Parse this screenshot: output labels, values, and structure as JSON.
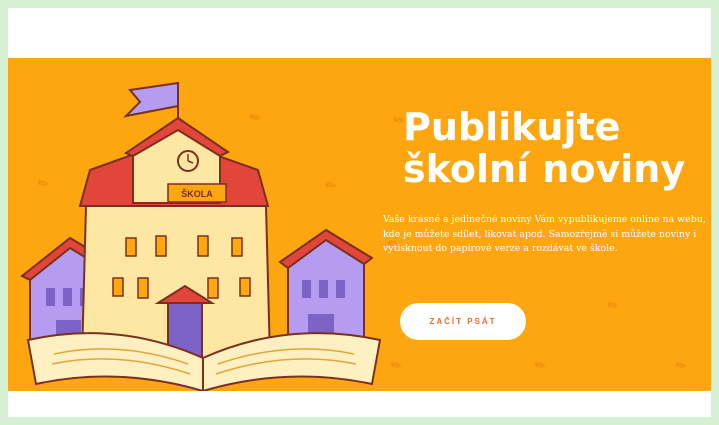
{
  "hero": {
    "title_line1": "Publikujte",
    "title_line2": "školní noviny",
    "description": "Vaše krásné a jedinečné noviny Vám vypublikujeme online na webu, kde je můžete sdílet, likovat apod. Samozřejmě si můžete noviny i vytisknout do papírové verze a rozdávat ve škole.",
    "cta_label": "ZAČÍT PSÁT",
    "illustration_sign": "ŠKOLA"
  },
  "colors": {
    "page_border": "#d6f0d3",
    "hero_background": "#fda60f",
    "cta_text": "#f06a2a",
    "roof": "#e2453a",
    "building": "#fde7a3",
    "side_buildings": "#b69cf0",
    "flag": "#b69cf0"
  },
  "icons": [
    "pencil-icon",
    "school-building-illustration",
    "open-book-illustration",
    "clock-icon",
    "flag-icon"
  ]
}
